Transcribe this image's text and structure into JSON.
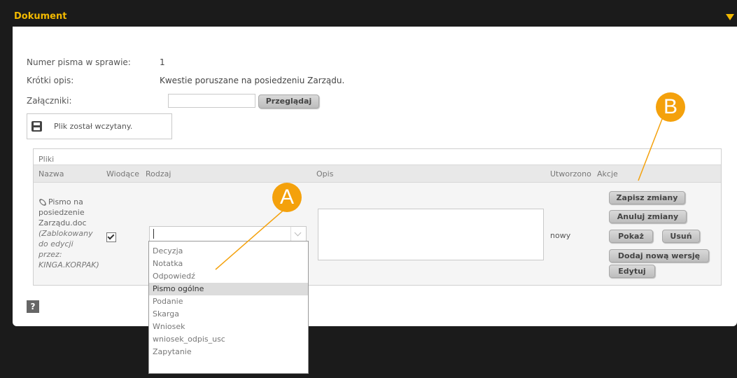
{
  "panel": {
    "title": "Dokument"
  },
  "doc": {
    "number_label": "Numer pisma w sprawie:",
    "number_value": "1",
    "desc_label": "Krótki opis:",
    "desc_value": "Kwestie poruszane na posiedzeniu Zarządu.",
    "attach_label": "Załączniki:",
    "browse_label": "Przeglądaj",
    "notice": "Plik został wczytany.",
    "help_label": "?"
  },
  "files": {
    "title": "Pliki",
    "columns": [
      "Nazwa",
      "Wiodące",
      "Rodzaj",
      "Opis",
      "Utworzono",
      "Akcje"
    ],
    "row": {
      "name_lines": [
        "Pismo na",
        "posiedzenie",
        "Zarządu.doc"
      ],
      "lock_lines": [
        "(Zablokowany",
        "do edycji",
        "przez:",
        "KINGA.KORPAK)"
      ],
      "leading_checked": true,
      "type_value": "",
      "created": "nowy"
    },
    "actions": {
      "save": "Zapisz zmiany",
      "cancel": "Anuluj zmiany",
      "show": "Pokaż",
      "delete": "Usuń",
      "add_version": "Dodaj nową wersję",
      "edit": "Edytuj"
    }
  },
  "type_options": [
    "Decyzja",
    "Notatka",
    "Odpowiedź",
    "Pismo ogólne",
    "Podanie",
    "Skarga",
    "Wniosek",
    "wniosek_odpis_usc",
    "Zapytanie"
  ],
  "type_selected": "Pismo ogólne",
  "markers": {
    "a": "A",
    "b": "B"
  },
  "colors": {
    "header_bg": "#1b1b1b",
    "title": "#f2b900",
    "marker": "#f4a10c"
  }
}
